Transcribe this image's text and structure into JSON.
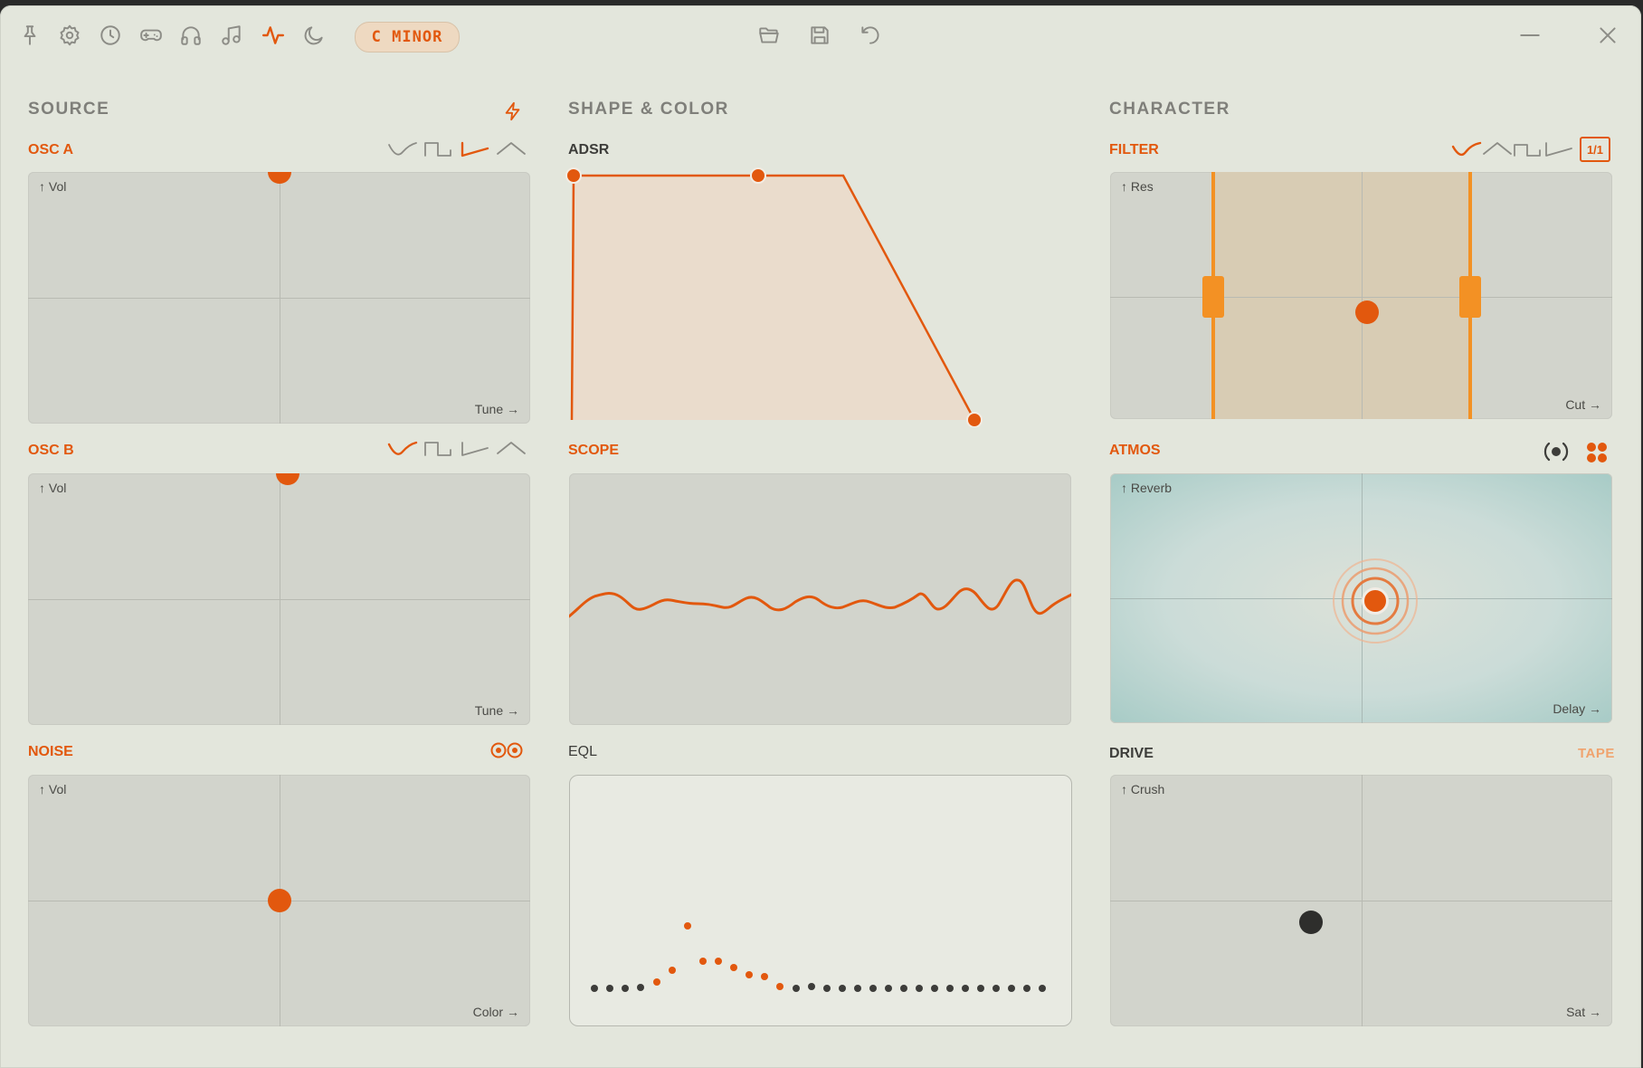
{
  "toolbar": {
    "icons": [
      "pin-icon",
      "settings-icon",
      "history-icon",
      "gamepad-icon",
      "headphones-icon",
      "music-note-icon",
      "activity-icon",
      "moon-icon"
    ],
    "active_icon": "activity-icon",
    "key": "C MINOR",
    "file_icons": [
      "open-folder-icon",
      "save-icon",
      "undo-icon"
    ],
    "window_icons": [
      "minimize-icon",
      "close-icon"
    ]
  },
  "accent_color": "#e2580e",
  "sections": {
    "source": "SOURCE",
    "shape": "SHAPE & COLOR",
    "character": "CHARACTER"
  },
  "osc_a": {
    "label": "OSC A",
    "y_axis": "↑ Vol",
    "x_axis": "Tune →",
    "wave_selected": "saw",
    "value": {
      "x": 0.5,
      "y": 1.0
    }
  },
  "osc_b": {
    "label": "OSC B",
    "y_axis": "↑ Vol",
    "x_axis": "Tune →",
    "wave_selected": "sine",
    "value": {
      "x": 0.52,
      "y": 1.0
    }
  },
  "noise": {
    "label": "NOISE",
    "y_axis": "↑ Vol",
    "x_axis": "Color →",
    "value": {
      "x": 0.5,
      "y": 0.5
    }
  },
  "adsr": {
    "label": "ADSR",
    "attack": 0.0,
    "decay": 0.46,
    "sustain": 1.0,
    "release": 0.33
  },
  "scope": {
    "label": "SCOPE"
  },
  "eql": {
    "label": "EQL"
  },
  "filter": {
    "label": "FILTER",
    "y_axis": "↑ Res",
    "x_axis": "Cut →",
    "ratio": "1/1",
    "value": {
      "x": 0.51,
      "y": 0.43
    },
    "band": [
      0.21,
      0.72
    ]
  },
  "atmos": {
    "label": "ATMOS",
    "y_axis": "↑ Reverb",
    "x_axis": "Delay →",
    "value": {
      "x": 0.53,
      "y": 0.45
    }
  },
  "drive": {
    "label": "DRIVE",
    "mode": "TAPE",
    "y_axis": "↑ Crush",
    "x_axis": "Sat →",
    "value": {
      "x": 0.4,
      "y": 0.42
    }
  }
}
